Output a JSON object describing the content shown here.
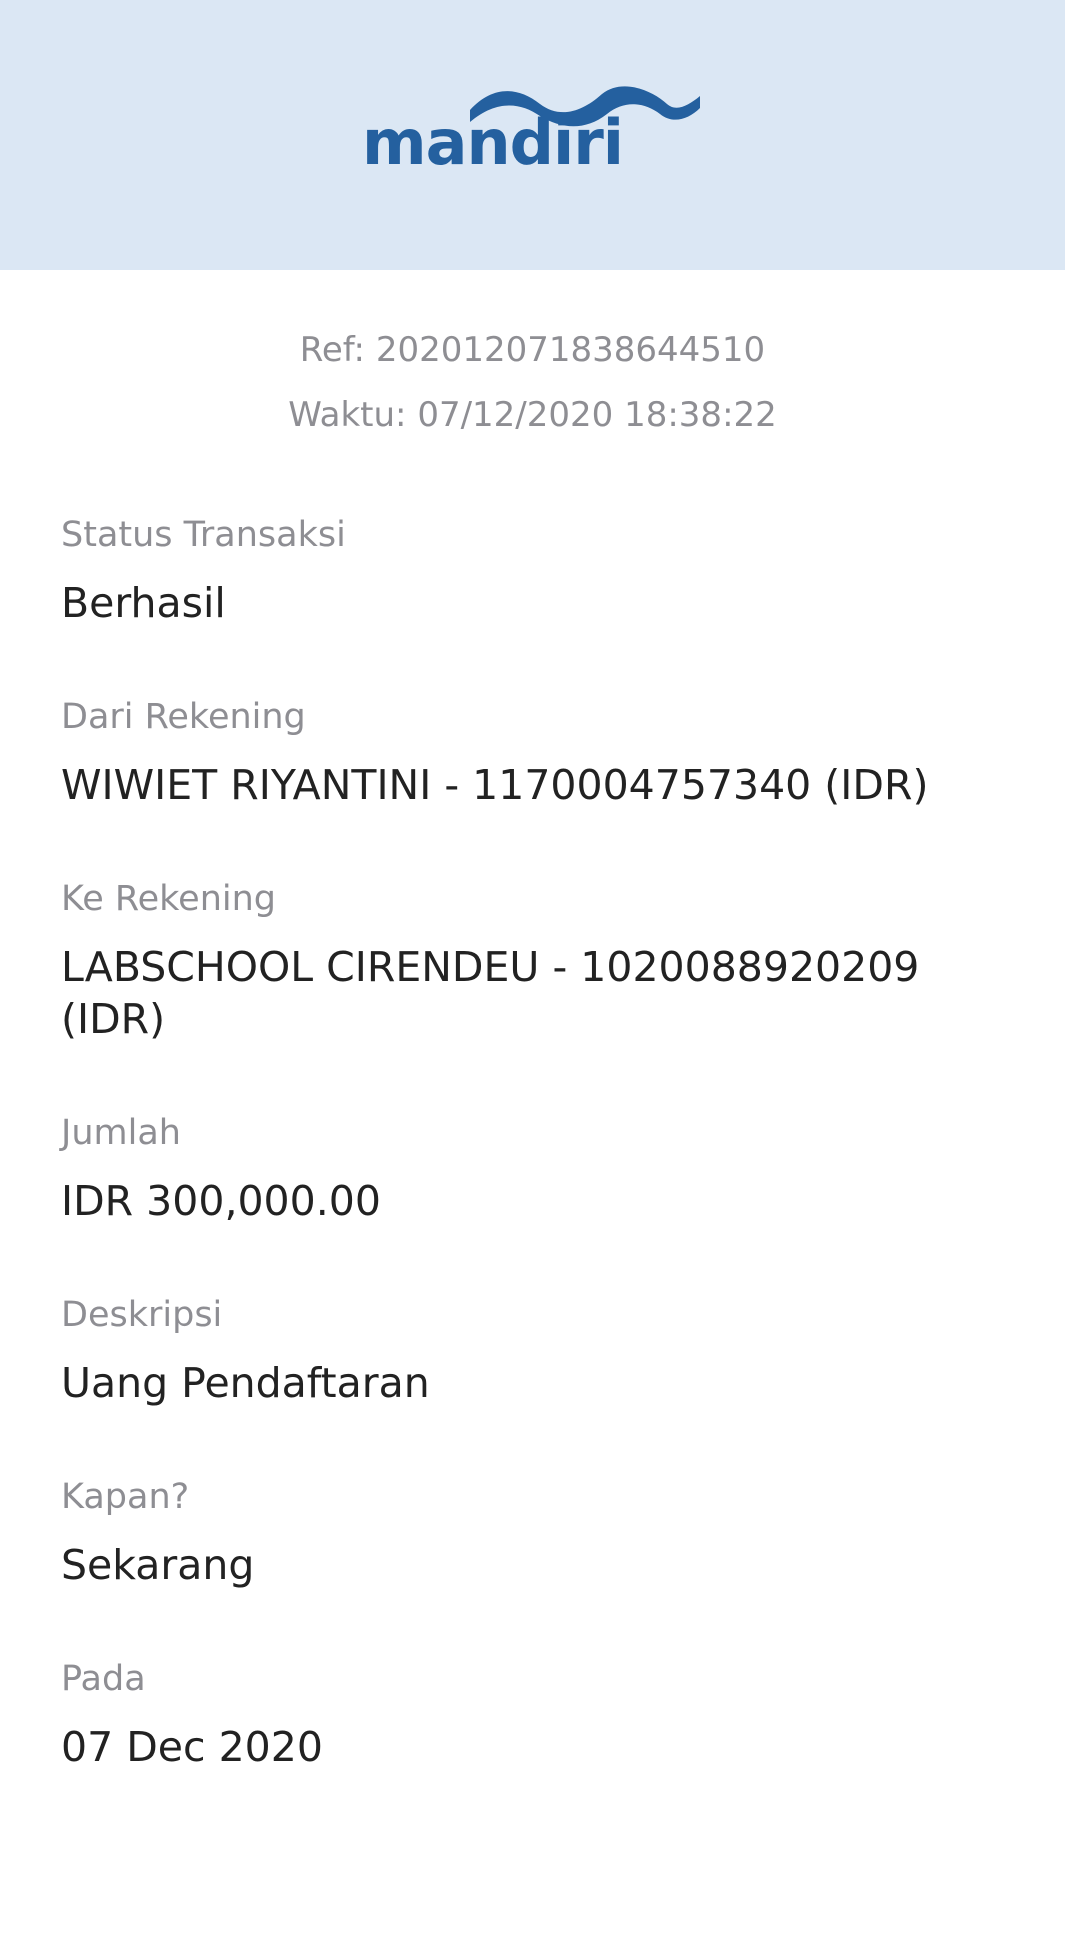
{
  "header": {
    "logo_text": "mandiri",
    "background_color": "#dbe7f4",
    "brand_color": "#24609f"
  },
  "meta": {
    "ref": "Ref: 202012071838644510",
    "time": "Waktu: 07/12/2020 18:38:22"
  },
  "fields": [
    {
      "label": "Status Transaksi",
      "value": "Berhasil"
    },
    {
      "label": "Dari Rekening",
      "value": "WIWIET RIYANTINI - 1170004757340 (IDR)"
    },
    {
      "label": "Ke Rekening",
      "value": "LABSCHOOL CIRENDEU - 1020088920209 (IDR)"
    },
    {
      "label": "Jumlah",
      "value": "IDR 300,000.00"
    },
    {
      "label": "Deskripsi",
      "value": "Uang Pendaftaran"
    },
    {
      "label": "Kapan?",
      "value": "Sekarang"
    },
    {
      "label": "Pada",
      "value": "07 Dec 2020"
    }
  ]
}
